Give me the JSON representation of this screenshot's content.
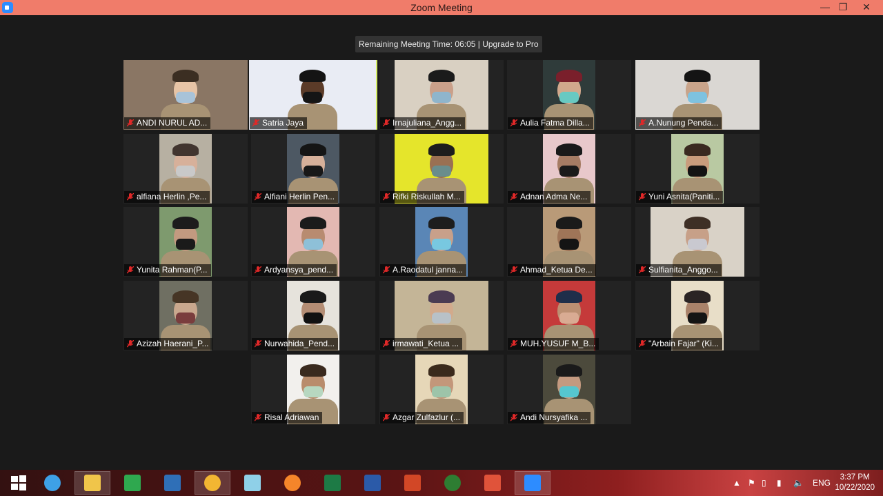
{
  "window": {
    "title": "Zoom Meeting",
    "minimize": "—",
    "restore": "❐",
    "close": "✕"
  },
  "banner": {
    "text": "Remaining Meeting Time: 06:05 | Upgrade to Pro"
  },
  "participants": [
    {
      "name": "ANDI NURUL AD...",
      "bg": "#8a7664",
      "skin": "#e7c4a6",
      "hat": "#3b2e22",
      "mask": "#a8c3d9"
    },
    {
      "name": "Satria Jaya",
      "bg": "#e9ecf4",
      "skin": "#5b3b28",
      "hat": "#141414",
      "mask": "#151515"
    },
    {
      "name": "Irnajuliana_Angg...",
      "bg": "#d9d0c2",
      "skin": "#caa08a",
      "hat": "#1b1b1b",
      "mask": "#8fb5cc"
    },
    {
      "name": "Aulia Fatma Dilla...",
      "bg": "#2f3b3a",
      "skin": "#d1a88c",
      "hat": "#7a1f2b",
      "mask": "#68c9c2"
    },
    {
      "name": "A.Nunung Penda...",
      "bg": "#dad7d3",
      "skin": "#c9a48a",
      "hat": "#141414",
      "mask": "#7ec2e0"
    },
    {
      "name": "alfiana Herlin ,Pe...",
      "bg": "#b7b0a2",
      "skin": "#d7b09a",
      "hat": "#42352f",
      "mask": "#c9c9c9"
    },
    {
      "name": "Alfiani Herlin Pen...",
      "bg": "#4d5863",
      "skin": "#d6b09a",
      "hat": "#151515",
      "mask": "#181818"
    },
    {
      "name": "Rifki Riskullah M...",
      "bg": "#e5e52b",
      "skin": "#9a7052",
      "hat": "#1d1d1d",
      "mask": "#6a8d8c"
    },
    {
      "name": "Adnan Adma Ne...",
      "bg": "#e8c8cb",
      "skin": "#a67c64",
      "hat": "#1a1a1a",
      "mask": "#1a1a1a"
    },
    {
      "name": "Yuni Asnita(Paniti...",
      "bg": "#b9c9a2",
      "skin": "#c99c7c",
      "hat": "#3a2a20",
      "mask": "#131313"
    },
    {
      "name": "Yunita Rahman(P...",
      "bg": "#7e9a6e",
      "skin": "#c29a80",
      "hat": "#1c1c1c",
      "mask": "#1a1a1a"
    },
    {
      "name": "Ardyansya_pend...",
      "bg": "#e3b8b2",
      "skin": "#b88b70",
      "hat": "#1b1b1b",
      "mask": "#8ec0d8"
    },
    {
      "name": "A.Raodatul janna...",
      "bg": "#5a86b6",
      "skin": "#c8a08a",
      "hat": "#1d1d1d",
      "mask": "#78c8e0"
    },
    {
      "name": "Ahmad_Ketua De...",
      "bg": "#b99a78",
      "skin": "#9f7558",
      "hat": "#1a1a1a",
      "mask": "#141414"
    },
    {
      "name": "Sulfianita_Anggo...",
      "bg": "#d9d2c7",
      "skin": "#c7a088",
      "hat": "#3e2f25",
      "mask": "#c9c9d0"
    },
    {
      "name": "Azizah Haerani_P...",
      "bg": "#6f6f62",
      "skin": "#c9a88e",
      "hat": "#463525",
      "mask": "#7a3d3d"
    },
    {
      "name": "Nurwahida_Pend...",
      "bg": "#e6e3dc",
      "skin": "#b48d74",
      "hat": "#1a1a1a",
      "mask": "#111111"
    },
    {
      "name": "irmawati_Ketua ...",
      "bg": "#c4b597",
      "skin": "#d2aa8c",
      "hat": "#4b3b52",
      "mask": "#b8c1c8"
    },
    {
      "name": "MUH.YUSUF M_B...",
      "bg": "#c53a3a",
      "skin": "#bb8f72",
      "hat": "#1f2e4a",
      "mask": "#d9ab93"
    },
    {
      "name": "\"Arbain Fajar\" (Ki...",
      "bg": "#e8dec8",
      "skin": "#a9826a",
      "hat": "#2a2424",
      "mask": "#141414"
    },
    {
      "name": "Risal Adriawan",
      "bg": "#f2f0ed",
      "skin": "#b98c6c",
      "hat": "#3a2a1e",
      "mask": "#b7d7c0"
    },
    {
      "name": "Azgar Zulfazlur (...",
      "bg": "#e6d7b8",
      "skin": "#c3977a",
      "hat": "#3b2a1c",
      "mask": "#9dc4a9"
    },
    {
      "name": "Andi Nursyafika ...",
      "bg": "#4c4a3c",
      "skin": "#c49a80",
      "hat": "#1a1a1a",
      "mask": "#56c6cf"
    }
  ],
  "taskbar": {
    "apps": [
      {
        "icon": "windows-start-icon",
        "color": "#ffffff"
      },
      {
        "icon": "internet-explorer-icon",
        "color": "#3ea0e6"
      },
      {
        "icon": "file-explorer-icon",
        "color": "#f0c54a"
      },
      {
        "icon": "store-icon",
        "color": "#2fa84f"
      },
      {
        "icon": "lenovo-icon",
        "color": "#2f6fb7"
      },
      {
        "icon": "chrome-icon",
        "color": "#f2b632"
      },
      {
        "icon": "notepad-icon",
        "color": "#8fd0e8"
      },
      {
        "icon": "firefox-icon",
        "color": "#f5852a"
      },
      {
        "icon": "excel-icon",
        "color": "#1d7a45"
      },
      {
        "icon": "word-icon",
        "color": "#2b5aa8"
      },
      {
        "icon": "powerpoint-icon",
        "color": "#d24726"
      },
      {
        "icon": "media-player-icon",
        "color": "#2e7d32"
      },
      {
        "icon": "app-red-icon",
        "color": "#e0533a"
      },
      {
        "icon": "zoom-icon",
        "color": "#2d8cff"
      }
    ],
    "language": "ENG",
    "time": "3:37 PM",
    "date": "10/22/2020"
  }
}
